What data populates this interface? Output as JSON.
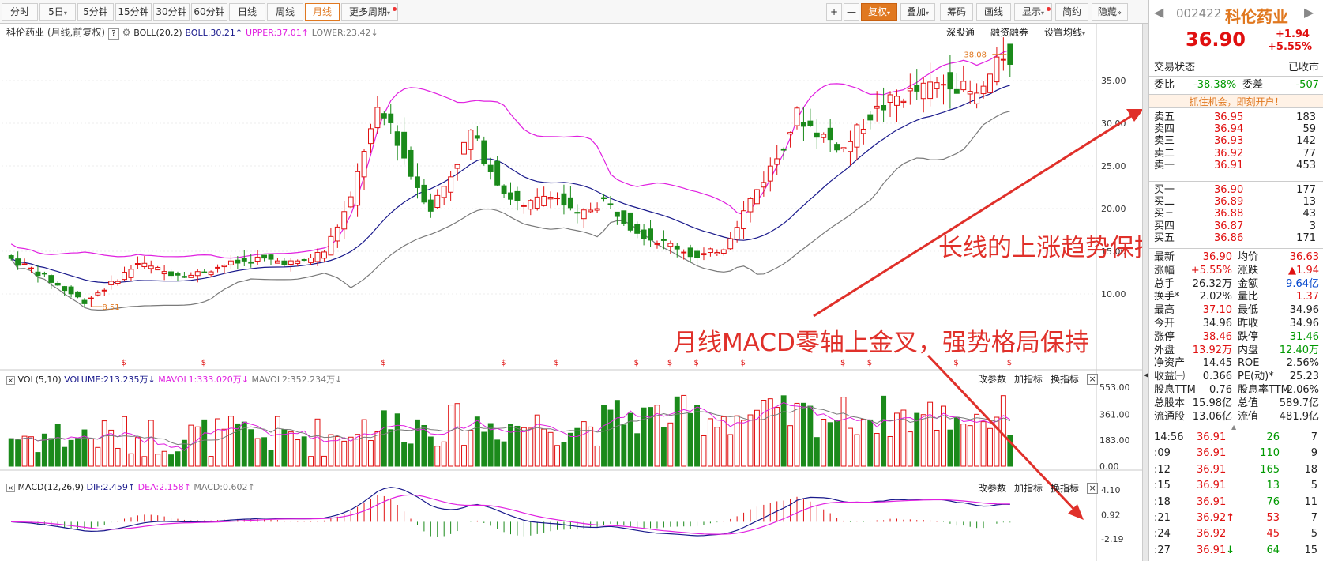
{
  "toolbar": {
    "periods": [
      "分时",
      "5日",
      "5分钟",
      "15分钟",
      "30分钟",
      "60分钟",
      "日线",
      "周线",
      "月线",
      "更多周期"
    ],
    "selected": "月线",
    "right": [
      "+",
      "—",
      "复权",
      "叠加",
      "筹码",
      "画线",
      "显示",
      "简约",
      "隐藏"
    ]
  },
  "chart_header": {
    "stock": "科伦药业",
    "mode": "(月线,前复权)",
    "boll_label": "BOLL(20,2)",
    "boll_value": "BOLL:30.21",
    "upper_value": "UPPER:37.01",
    "lower_value": "LOWER:23.42",
    "links": [
      "深股通",
      "融资融券",
      "设置均线"
    ]
  },
  "vol_header": {
    "label": "VOL(5,10)",
    "volume": "VOLUME:213.235万",
    "mavol1": "MAVOL1:333.020万",
    "mavol2": "MAVOL2:352.234万",
    "buttons": [
      "改参数",
      "加指标",
      "换指标"
    ]
  },
  "macd_header": {
    "label": "MACD(12,26,9)",
    "dif": "DIF:2.459",
    "dea": "DEA:2.158",
    "macd": "MACD:0.602",
    "buttons": [
      "改参数",
      "加指标",
      "换指标"
    ]
  },
  "axes": {
    "price_ticks": [
      "35.00",
      "30.00",
      "25.00",
      "20.00",
      "15.00",
      "10.00"
    ],
    "vol_ticks": [
      "553.00",
      "361.00",
      "183.00",
      "0.00"
    ],
    "macd_ticks": [
      "4.10",
      "0.92",
      "-2.19"
    ],
    "high_label": "38.08",
    "low_label": "8.51"
  },
  "annotations": {
    "trend_text": "长线的上涨趋势保持",
    "macd_text": "月线MACD零轴上金叉，强势格局保持"
  },
  "quote": {
    "code": "002422",
    "name": "科伦药业",
    "price": "36.90",
    "change": "+1.94",
    "change_pct": "+5.55%",
    "trade_status_label": "交易状态",
    "trade_status": "已收市",
    "wb_label": "委比",
    "wb": "-38.38%",
    "wc_label": "委差",
    "wc": "-507",
    "promo": "抓住机会，即刻开户！",
    "asks": [
      {
        "label": "卖五",
        "price": "36.95",
        "vol": "183"
      },
      {
        "label": "卖四",
        "price": "36.94",
        "vol": "59"
      },
      {
        "label": "卖三",
        "price": "36.93",
        "vol": "142"
      },
      {
        "label": "卖二",
        "price": "36.92",
        "vol": "77"
      },
      {
        "label": "卖一",
        "price": "36.91",
        "vol": "453"
      }
    ],
    "bids": [
      {
        "label": "买一",
        "price": "36.90",
        "vol": "177"
      },
      {
        "label": "买二",
        "price": "36.89",
        "vol": "13"
      },
      {
        "label": "买三",
        "price": "36.88",
        "vol": "43"
      },
      {
        "label": "买四",
        "price": "36.87",
        "vol": "3"
      },
      {
        "label": "买五",
        "price": "36.86",
        "vol": "171"
      }
    ],
    "stats": [
      {
        "k1": "最新",
        "v1": "36.90",
        "c1": "red",
        "k2": "均价",
        "v2": "36.63",
        "c2": "red"
      },
      {
        "k1": "涨幅",
        "v1": "+5.55%",
        "c1": "red",
        "k2": "涨跌",
        "v2": "▲1.94",
        "c2": "red"
      },
      {
        "k1": "总手",
        "v1": "26.32万",
        "c1": "",
        "k2": "金额",
        "v2": "9.64亿",
        "c2": "blue"
      },
      {
        "k1": "换手*",
        "v1": "2.02%",
        "c1": "",
        "k2": "量比",
        "v2": "1.37",
        "c2": "red"
      },
      {
        "k1": "最高",
        "v1": "37.10",
        "c1": "red",
        "k2": "最低",
        "v2": "34.96",
        "c2": ""
      },
      {
        "k1": "今开",
        "v1": "34.96",
        "c1": "",
        "k2": "昨收",
        "v2": "34.96",
        "c2": ""
      },
      {
        "k1": "涨停",
        "v1": "38.46",
        "c1": "red",
        "k2": "跌停",
        "v2": "31.46",
        "c2": "green"
      },
      {
        "k1": "外盘",
        "v1": "13.92万",
        "c1": "red",
        "k2": "内盘",
        "v2": "12.40万",
        "c2": "green"
      },
      {
        "k1": "净资产",
        "v1": "14.45",
        "c1": "",
        "k2": "ROE",
        "v2": "2.56%",
        "c2": ""
      },
      {
        "k1": "收益㈠",
        "v1": "0.366",
        "c1": "",
        "k2": "PE(动)*",
        "v2": "25.23",
        "c2": ""
      },
      {
        "k1": "股息TTM",
        "v1": "0.76",
        "c1": "",
        "k2": "股息率TTM",
        "v2": "2.06%",
        "c2": ""
      },
      {
        "k1": "总股本",
        "v1": "15.98亿",
        "c1": "",
        "k2": "总值",
        "v2": "589.7亿",
        "c2": ""
      },
      {
        "k1": "流通股",
        "v1": "13.06亿",
        "c1": "",
        "k2": "流值",
        "v2": "481.9亿",
        "c2": ""
      }
    ],
    "ticks": [
      {
        "t": "14:56",
        "p": "36.91",
        "v": "26",
        "n": "7",
        "vc": "green",
        "arrow": ""
      },
      {
        "t": ":09",
        "p": "36.91",
        "v": "110",
        "n": "9",
        "vc": "green",
        "arrow": ""
      },
      {
        "t": ":12",
        "p": "36.91",
        "v": "165",
        "n": "18",
        "vc": "green",
        "arrow": ""
      },
      {
        "t": ":15",
        "p": "36.91",
        "v": "13",
        "n": "5",
        "vc": "green",
        "arrow": ""
      },
      {
        "t": ":18",
        "p": "36.91",
        "v": "76",
        "n": "11",
        "vc": "green",
        "arrow": ""
      },
      {
        "t": ":21",
        "p": "36.92",
        "v": "53",
        "n": "7",
        "vc": "red",
        "arrow": "up"
      },
      {
        "t": ":24",
        "p": "36.92",
        "v": "45",
        "n": "5",
        "vc": "red",
        "arrow": ""
      },
      {
        "t": ":27",
        "p": "36.91",
        "v": "64",
        "n": "15",
        "vc": "green",
        "arrow": "down"
      }
    ]
  },
  "colors": {
    "up": "#e01010",
    "down": "#1b8a1b",
    "mid": "#1a1a8c",
    "upper": "#e020e0",
    "lower": "#7a7a7a",
    "accent": "#e07820"
  }
}
